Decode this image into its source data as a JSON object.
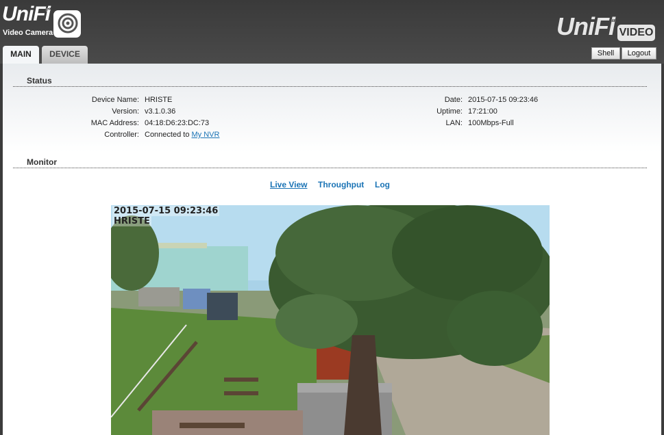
{
  "header": {
    "logo_left": {
      "brand": "UniFi",
      "sub": "Video Camera",
      "icon": "camera-lens-icon"
    },
    "logo_right": {
      "brand": "UniFi",
      "badge": "VIDEO"
    },
    "buttons": {
      "shell": "Shell",
      "logout": "Logout"
    }
  },
  "tabs": [
    {
      "label": "MAIN"
    },
    {
      "label": "DEVICE"
    }
  ],
  "status": {
    "title": "Status",
    "device_name_label": "Device Name:",
    "device_name": "HRISTE",
    "version_label": "Version:",
    "version": "v3.1.0.36",
    "mac_label": "MAC Address:",
    "mac": "04:18:D6:23:DC:73",
    "controller_label": "Controller:",
    "controller_prefix": "Connected to",
    "controller_link": "My NVR",
    "date_label": "Date:",
    "date": "2015-07-15 09:23:46",
    "uptime_label": "Uptime:",
    "uptime": "17:21:00",
    "lan_label": "LAN:",
    "lan": "100Mbps-Full"
  },
  "monitor": {
    "title": "Monitor",
    "links": [
      {
        "label": "Live View"
      },
      {
        "label": "Throughput"
      },
      {
        "label": "Log"
      }
    ],
    "osd_time": "2015-07-15 09:23:46",
    "osd_name": "HRISTE"
  },
  "colors": {
    "header_bg": "#404040",
    "link": "#1a73b5",
    "content_bg": "#ffffff"
  }
}
